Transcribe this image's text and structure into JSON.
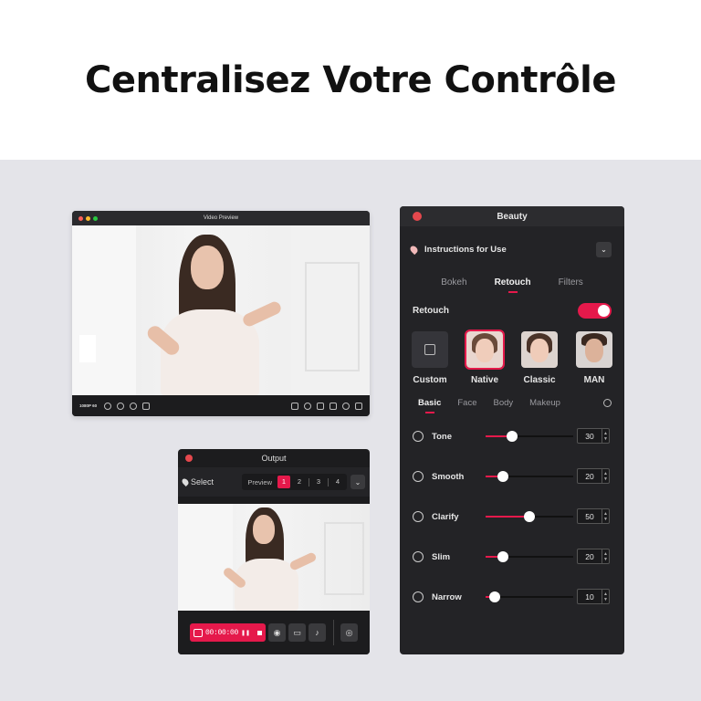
{
  "hero": {
    "title": "Centralisez Votre Contrôle"
  },
  "video_preview": {
    "title": "Video Preview",
    "resolution": "1080P 60"
  },
  "output": {
    "title": "Output",
    "select_label": "Select",
    "preview_label": "Preview",
    "pages": [
      "1",
      "2",
      "3",
      "4"
    ],
    "active_page": "1",
    "timer": "00:00:00",
    "chevron": "⌄"
  },
  "beauty": {
    "title": "Beauty",
    "instructions": "Instructions for Use",
    "tabs": [
      "Bokeh",
      "Retouch",
      "Filters"
    ],
    "active_tab": "Retouch",
    "retouch_label": "Retouch",
    "retouch_enabled": true,
    "presets": [
      {
        "label": "Custom"
      },
      {
        "label": "Native"
      },
      {
        "label": "Classic"
      },
      {
        "label": "MAN"
      }
    ],
    "selected_preset": "Native",
    "subtabs": [
      "Basic",
      "Face",
      "Body",
      "Makeup"
    ],
    "active_subtab": "Basic",
    "sliders": [
      {
        "name": "Tone",
        "value": 30
      },
      {
        "name": "Smooth",
        "value": 20
      },
      {
        "name": "Clarify",
        "value": 50
      },
      {
        "name": "Slim",
        "value": 20
      },
      {
        "name": "Narrow",
        "value": 10
      }
    ]
  },
  "colors": {
    "accent": "#e5194b",
    "panel": "#232326",
    "stage": "#e4e4e9"
  }
}
